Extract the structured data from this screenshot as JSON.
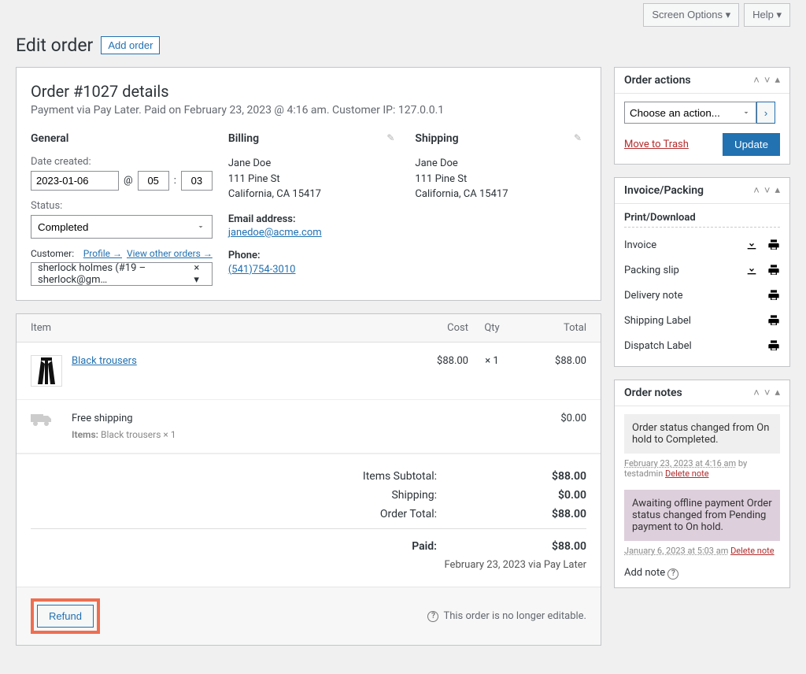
{
  "topbar": {
    "screen_options": "Screen Options",
    "help": "Help"
  },
  "header": {
    "title": "Edit order",
    "add_order": "Add order"
  },
  "order": {
    "heading": "Order #1027 details",
    "meta_line": "Payment via Pay Later. Paid on February 23, 2023 @ 4:16 am. Customer IP: 127.0.0.1",
    "general": {
      "heading": "General",
      "date_label": "Date created:",
      "date": "2023-01-06",
      "at": "@",
      "hour": "05",
      "sep": ":",
      "min": "03",
      "status_label": "Status:",
      "status": "Completed",
      "customer_label": "Customer:",
      "profile_link": "Profile →",
      "other_orders_link": "View other orders →",
      "customer_value": "sherlock holmes (#19 – sherlock@gm…"
    },
    "billing": {
      "heading": "Billing",
      "name": "Jane Doe",
      "street": "111 Pine St",
      "citystate": "California, CA 15417",
      "email_lbl": "Email address:",
      "email": "janedoe@acme.com",
      "phone_lbl": "Phone:",
      "phone": "(541)754-3010"
    },
    "shipping": {
      "heading": "Shipping",
      "name": "Jane Doe",
      "street": "111 Pine St",
      "citystate": "California, CA 15417"
    }
  },
  "items": {
    "headers": {
      "item": "Item",
      "cost": "Cost",
      "qty": "Qty",
      "total": "Total"
    },
    "rows": [
      {
        "name": "Black trousers",
        "cost": "$88.00",
        "qty": "× 1",
        "total": "$88.00",
        "thumb": "👖"
      }
    ],
    "shipping_row": {
      "name": "Free shipping",
      "sub_label": "Items:",
      "sub_value": "Black trousers × 1",
      "total": "$0.00"
    },
    "totals": {
      "subtotal_lbl": "Items Subtotal:",
      "subtotal": "$88.00",
      "shipping_lbl": "Shipping:",
      "shipping": "$0.00",
      "ordertotal_lbl": "Order Total:",
      "ordertotal": "$88.00",
      "paid_lbl": "Paid:",
      "paid": "$88.00",
      "paid_via": "February 23, 2023 via Pay Later"
    },
    "refund": "Refund",
    "noedit": "This order is no longer editable."
  },
  "sidebar": {
    "actions": {
      "title": "Order actions",
      "choose": "Choose an action...",
      "trash": "Move to Trash",
      "update": "Update"
    },
    "invoice": {
      "title": "Invoice/Packing",
      "pd": "Print/Download",
      "rows": [
        "Invoice",
        "Packing slip",
        "Delivery note",
        "Shipping Label",
        "Dispatch Label"
      ]
    },
    "notes": {
      "title": "Order notes",
      "items": [
        {
          "text": "Order status changed from On hold to Completed.",
          "meta": "February 23, 2023 at 4:16 am",
          "by": " by testadmin",
          "del": "Delete note",
          "cls": ""
        },
        {
          "text": "Awaiting offline payment Order status changed from Pending payment to On hold.",
          "meta": "January 6, 2023 at 5:03 am",
          "by": "",
          "del": "Delete note",
          "cls": "purple"
        }
      ],
      "add_note": "Add note"
    }
  }
}
